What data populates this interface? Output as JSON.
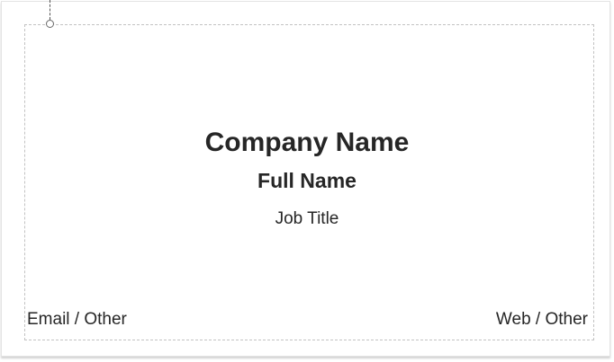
{
  "card": {
    "company_name": "Company Name",
    "full_name": "Full Name",
    "job_title": "Job Title",
    "email_other": "Email / Other",
    "web_other": "Web / Other"
  },
  "colors": {
    "text": "#262626",
    "guide": "#c2c2c2",
    "card_border": "#e4e4e4"
  }
}
